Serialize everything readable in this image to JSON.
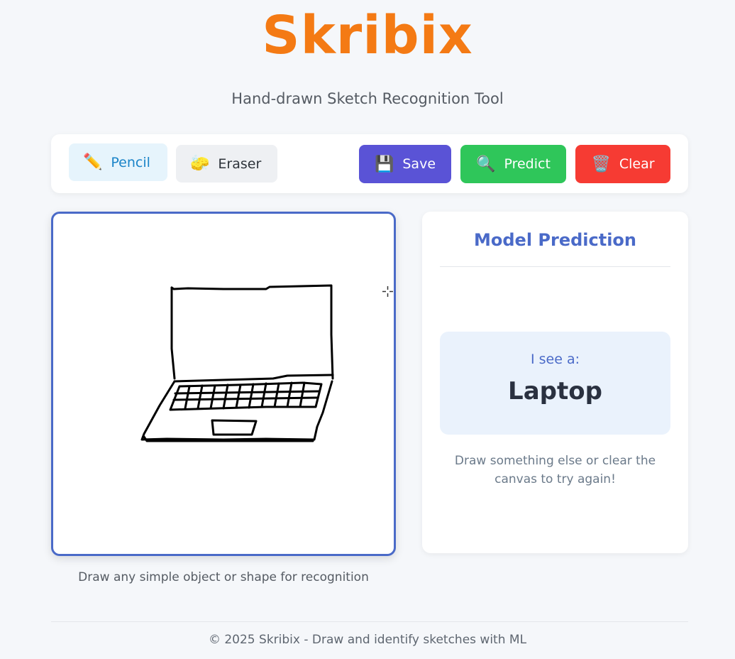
{
  "app": {
    "logo": "Skribix",
    "subtitle": "Hand-drawn Sketch Recognition Tool"
  },
  "toolbar": {
    "pencil": {
      "icon": "pencil-icon",
      "glyph": "✏️",
      "label": "Pencil",
      "active": true
    },
    "eraser": {
      "icon": "sponge-icon",
      "glyph": "🧽",
      "label": "Eraser"
    },
    "save": {
      "icon": "floppy-disk-icon",
      "glyph": "💾",
      "label": "Save",
      "color": "#5a53d6"
    },
    "predict": {
      "icon": "magnifier-icon",
      "glyph": "🔍",
      "label": "Predict",
      "color": "#2fc65a"
    },
    "clear": {
      "icon": "trash-icon",
      "glyph": "🗑️",
      "label": "Clear",
      "color": "#f63b33"
    }
  },
  "canvas": {
    "caption": "Draw any simple object or shape for recognition",
    "sketch": "laptop",
    "border_color": "#4a6ac8"
  },
  "prediction": {
    "title": "Model Prediction",
    "label": "I see a:",
    "value": "Laptop",
    "hint": "Draw something else or clear the canvas to try again!"
  },
  "footer": {
    "text": "© 2025 Skribix - Draw and identify sketches with ML"
  },
  "colors": {
    "brand": "#f47a14",
    "accent": "#4a6ac8"
  }
}
